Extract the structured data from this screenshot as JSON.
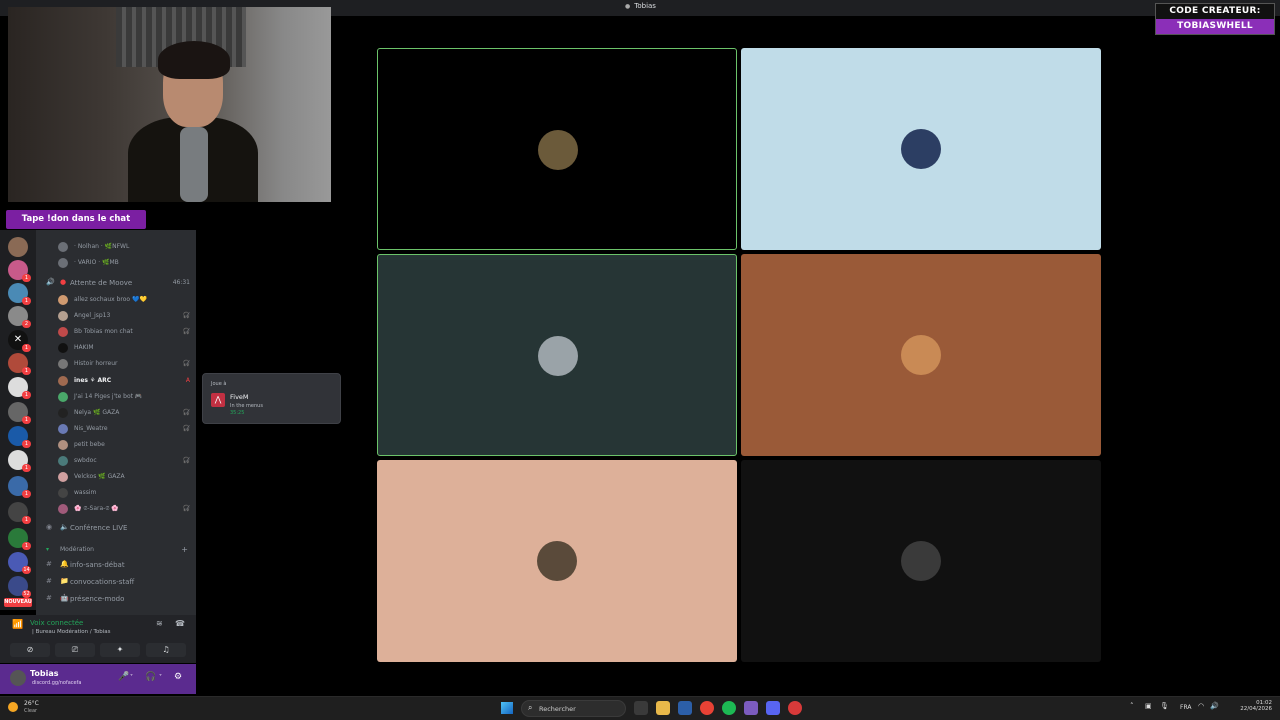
{
  "window": {
    "title": "Tobias"
  },
  "creator_code": {
    "line1": "CODE CREATEUR:",
    "line2": "TOBIASWHELL"
  },
  "follow_banner": "Tape !don dans le chat",
  "server_badges": [
    "1",
    "1",
    "2",
    "1",
    "1",
    "1",
    "1",
    "1",
    "1",
    "1",
    "1",
    "1",
    "14",
    "52"
  ],
  "new_badge": "NOUVEAU",
  "channel_members_top": [
    {
      "name": "· Nolhan · 🌿NFWL"
    },
    {
      "name": "· VARIO · 🌿MB"
    }
  ],
  "voice_channel": {
    "name": "Attente de Moove",
    "time": "46:31"
  },
  "members": [
    {
      "name": "allez sochaux broo 💙💛",
      "icon": ""
    },
    {
      "name": "Angel_jsp13",
      "icon": "🎧̸"
    },
    {
      "name": "Bb Tobias mon chat",
      "icon": "🎧̸"
    },
    {
      "name": "HAKIM",
      "icon": ""
    },
    {
      "name": "Histoir horreur",
      "icon": "🎧̸"
    },
    {
      "name": "ines ⚘ ARC",
      "icon": "A"
    },
    {
      "name": "J'ai 14 Piges j'te bot 🎮",
      "icon": ""
    },
    {
      "name": "Nelya 🌿 GAZA",
      "icon": "🎧̸"
    },
    {
      "name": "Nis_Weatre",
      "icon": "🎧̸"
    },
    {
      "name": "petit bebe",
      "icon": ""
    },
    {
      "name": "swbdoc",
      "icon": "🎧̸"
    },
    {
      "name": "Velckos 🌿 GAZA",
      "icon": ""
    },
    {
      "name": "wassim",
      "icon": ""
    },
    {
      "name": "🌸 𝕾-Sara-𝕾 🌸",
      "icon": "🎧̸"
    }
  ],
  "conference": {
    "name": "Conférence LIVE"
  },
  "category": {
    "name": "Modération"
  },
  "text_channels": [
    {
      "name": "info-sans-débat"
    },
    {
      "name": "convocations-staff"
    },
    {
      "name": "présence-modo"
    }
  ],
  "voice_panel": {
    "status": "Voix connectée",
    "location": "| Bureau Modération / Tobias"
  },
  "user": {
    "name": "Tobias",
    "status": "discord.gg/nofacefa"
  },
  "activity_popup": {
    "label": "Joue à",
    "game": "FiveM",
    "state": "In the menus",
    "elapsed": "35:25"
  },
  "tiles": [
    {
      "name": "tile-1",
      "bg": "#000000",
      "speaking": true,
      "face": "#6b5a3a"
    },
    {
      "name": "tile-2",
      "bg": "#c0dce8",
      "speaking": false,
      "face": "#2c3e63"
    },
    {
      "name": "tile-3",
      "bg": "#263535",
      "speaking": true,
      "face": "#9aa3a8"
    },
    {
      "name": "tile-4",
      "bg": "#9a5a38",
      "speaking": false,
      "face": "#c98a55"
    },
    {
      "name": "tile-5",
      "bg": "#ddb099",
      "speaking": false,
      "face": "#5a4a3a"
    },
    {
      "name": "tile-6",
      "bg": "#111111",
      "speaking": false,
      "face": "#3a3a3a"
    }
  ],
  "taskbar": {
    "temperature": "26°C",
    "weather": "Clear",
    "search_placeholder": "Rechercher",
    "language": "FRA",
    "time": "01:02",
    "date": "22/04/2026"
  },
  "colors": {
    "accent_purple": "#7b1fa2",
    "speaking_green": "#6cc36a",
    "voice_green": "#23a55a"
  }
}
